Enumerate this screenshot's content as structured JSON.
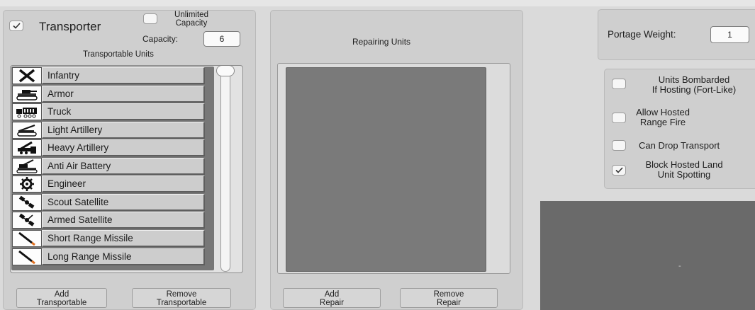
{
  "transporter": {
    "label": "Transporter",
    "checked": true,
    "unlimited_capacity_label": "Unlimited Capacity",
    "unlimited_capacity_checked": false,
    "capacity_label": "Capacity:",
    "capacity_value": "6",
    "list_title": "Transportable Units",
    "units": [
      {
        "name": "Infantry",
        "icon": "infantry-icon"
      },
      {
        "name": "Armor",
        "icon": "tank-icon"
      },
      {
        "name": "Truck",
        "icon": "truck-icon"
      },
      {
        "name": "Light Artillery",
        "icon": "light-artillery-icon"
      },
      {
        "name": "Heavy Artillery",
        "icon": "heavy-artillery-icon"
      },
      {
        "name": "Anti Air Battery",
        "icon": "anti-air-icon"
      },
      {
        "name": "Engineer",
        "icon": "engineer-gear-icon"
      },
      {
        "name": "Scout Satellite",
        "icon": "satellite-icon"
      },
      {
        "name": "Armed Satellite",
        "icon": "armed-satellite-icon"
      },
      {
        "name": "Short Range Missile",
        "icon": "missile-icon"
      },
      {
        "name": "Long Range Missile",
        "icon": "missile-icon"
      }
    ],
    "add_button": [
      "Add",
      "Transportable"
    ],
    "remove_button": [
      "Remove",
      "Transportable"
    ]
  },
  "repair": {
    "title": "Repairing Units",
    "add_button": [
      "Add",
      "Repair"
    ],
    "remove_button": [
      "Remove",
      "Repair"
    ]
  },
  "portage": {
    "label": "Portage Weight:",
    "value": "1"
  },
  "options": [
    {
      "label": [
        "Units Bombarded",
        "If Hosting (Fort-Like)"
      ],
      "checked": false
    },
    {
      "label": [
        "Allow Hosted",
        "Range Fire"
      ],
      "checked": false
    },
    {
      "label": [
        "Can Drop Transport"
      ],
      "checked": false
    },
    {
      "label": [
        "Block Hosted Land",
        "Unit Spotting"
      ],
      "checked": true
    }
  ],
  "preview": {
    "text": "-"
  },
  "colors": {
    "panel": "#cfcfcf",
    "list_dark": "#777777",
    "row": "#cdcdcd"
  }
}
